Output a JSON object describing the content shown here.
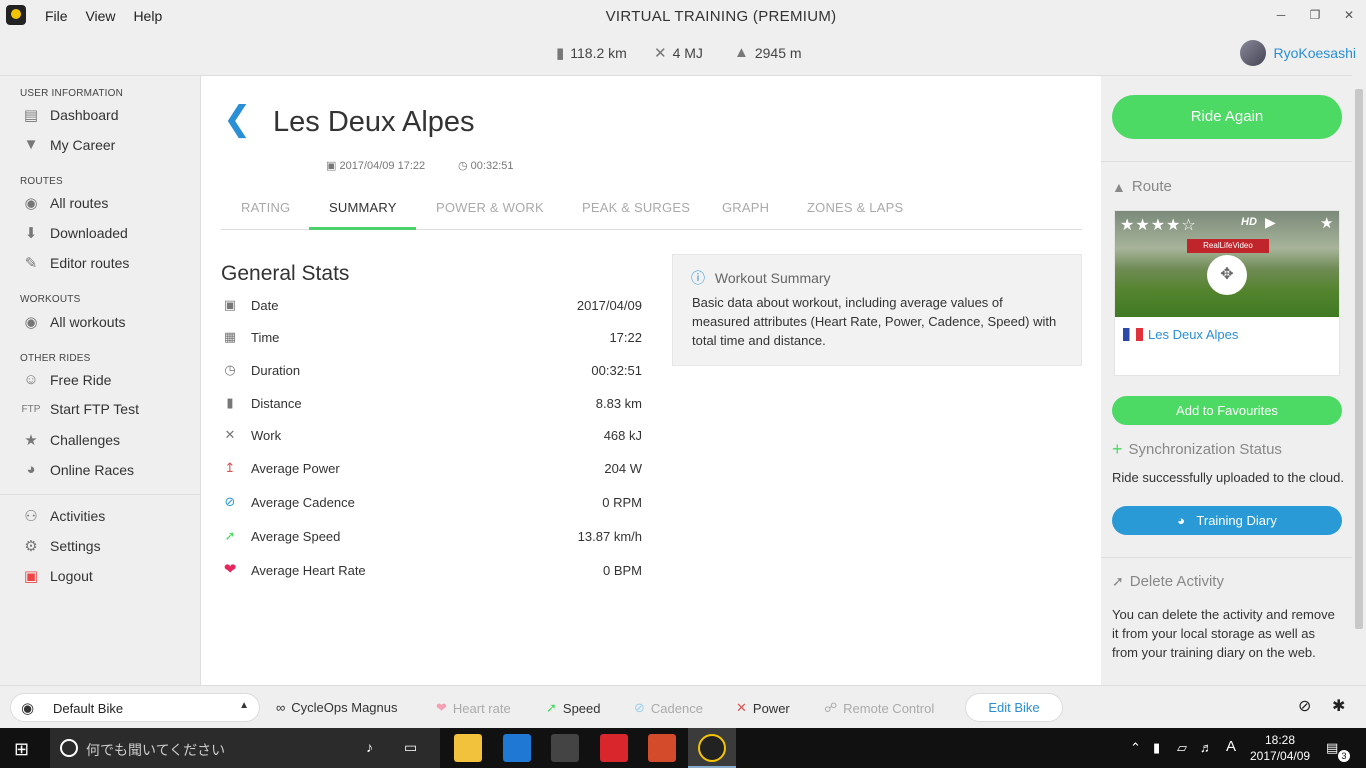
{
  "window": {
    "title": "VIRTUAL TRAINING (PREMIUM)",
    "menu": [
      "File",
      "View",
      "Help"
    ]
  },
  "header": {
    "distance": "118.2 km",
    "energy": "4 MJ",
    "elevation": "2945 m",
    "username": "RyoKoesashi"
  },
  "sidebar": {
    "sections": {
      "user": "USER INFORMATION",
      "routes": "ROUTES",
      "workouts": "WORKOUTS",
      "other": "OTHER RIDES"
    },
    "items": {
      "dashboard": "Dashboard",
      "career": "My Career",
      "all_routes": "All routes",
      "downloaded": "Downloaded",
      "editor_routes": "Editor routes",
      "all_workouts": "All workouts",
      "free_ride": "Free Ride",
      "ftp_test": "Start FTP Test",
      "ftp_label": "FTP",
      "challenges": "Challenges",
      "online_races": "Online Races",
      "activities": "Activities",
      "settings": "Settings",
      "logout": "Logout"
    }
  },
  "main": {
    "title": "Les Deux Alpes",
    "date": "2017/04/09 17:22",
    "duration": "00:32:51",
    "tabs": [
      "RATING",
      "SUMMARY",
      "POWER & WORK",
      "PEAK & SURGES",
      "GRAPH",
      "ZONES & LAPS"
    ],
    "active_tab": "SUMMARY",
    "general_stats_title": "General Stats",
    "stats": [
      {
        "label": "Date",
        "value": "2017/04/09"
      },
      {
        "label": "Time",
        "value": "17:22"
      },
      {
        "label": "Duration",
        "value": "00:32:51"
      },
      {
        "label": "Distance",
        "value": "8.83 km"
      },
      {
        "label": "Work",
        "value": "468 kJ"
      },
      {
        "label": "Average Power",
        "value": "204 W"
      },
      {
        "label": "Average Cadence",
        "value": "0 RPM"
      },
      {
        "label": "Average Speed",
        "value": "13.87 km/h"
      },
      {
        "label": "Average Heart Rate",
        "value": "0 BPM"
      }
    ],
    "summary": {
      "title": "Workout Summary",
      "body": "Basic data about workout, including average values of measured attributes (Heart Rate, Power, Cadence, Speed) with total time and distance."
    }
  },
  "right": {
    "ride_again": "Ride Again",
    "route_head": "Route",
    "route_name": "Les Deux Alpes",
    "rating_stars": 4,
    "hd_badge": "HD",
    "brand_banner": "RealLifeVideo",
    "add_favourites": "Add to Favourites",
    "sync_head": "Synchronization Status",
    "sync_text": "Ride successfully uploaded to the cloud.",
    "training_diary": "Training Diary",
    "delete_head": "Delete Activity",
    "delete_text": "You can delete the activity and remove it from your local storage as well as from your training diary on the web."
  },
  "devices": {
    "bike": "Default Bike",
    "trainer": "CycleOps Magnus",
    "heart_rate": "Heart rate",
    "speed": "Speed",
    "cadence": "Cadence",
    "power": "Power",
    "remote": "Remote Control",
    "edit_bike": "Edit Bike"
  },
  "taskbar": {
    "search_placeholder": "何でも聞いてください",
    "time": "18:28",
    "date": "2017/04/09",
    "ime": "A",
    "notifications": "3"
  },
  "colors": {
    "accent_blue": "#2a8fd6",
    "accent_green": "#4cd964",
    "heart_red": "#e8265e"
  }
}
